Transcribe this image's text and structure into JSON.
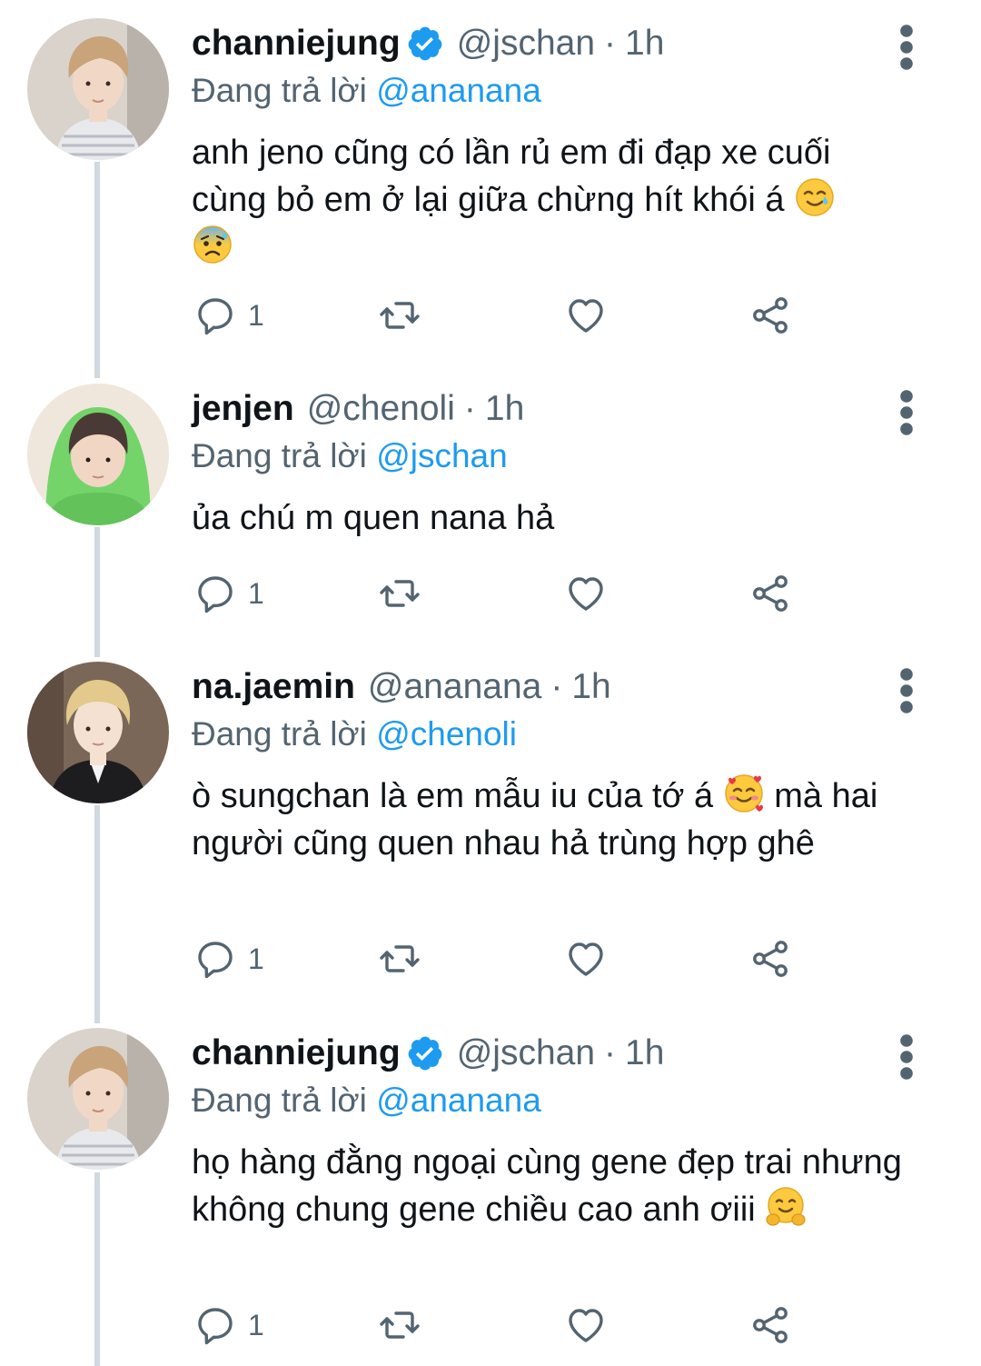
{
  "tweets": [
    {
      "display_name": "channiejung",
      "verified": true,
      "handle": "@jschan",
      "separator": "·",
      "time": "1h",
      "replying_prefix": "Đang trả lời",
      "replying_to": "@ananana",
      "text": "anh jeno cũng có lần rủ em đi đạp xe cuối cùng bỏ em ở lại giữa chừng hít khói á",
      "emojis": [
        "smiling-face-with-tear",
        "anxious-face-with-sweat"
      ],
      "reply_count": "1",
      "avatar_colors": {
        "bg": "#d9d3cc",
        "hair": "#c9a37a",
        "skin": "#f1d8c6",
        "shirt": "#e8e9ec"
      }
    },
    {
      "display_name": "jenjen",
      "verified": false,
      "handle": "@chenoli",
      "separator": "·",
      "time": "1h",
      "replying_prefix": "Đang trả lời",
      "replying_to": "@jschan",
      "text": "ủa chú m quen nana hả",
      "emojis": [],
      "reply_count": "1",
      "avatar_colors": {
        "bg": "#efe7dc",
        "hair": "#4a3a36",
        "skin": "#f2d6c4",
        "shirt": "#74d46a"
      }
    },
    {
      "display_name": "na.jaemin",
      "verified": false,
      "handle": "@ananana",
      "separator": "·",
      "time": "1h",
      "replying_prefix": "Đang trả lời",
      "replying_to": "@chenoli",
      "text_before_emoji": "ò sungchan là em mẫu iu của tớ á",
      "text_after_emoji": "mà hai người cũng quen nhau hả trùng hợp ghê",
      "emojis": [
        "smiling-face-with-hearts"
      ],
      "reply_count": "1",
      "avatar_colors": {
        "bg": "#7a6757",
        "hair": "#e3c98b",
        "skin": "#f4e1d2",
        "shirt": "#1d1d20"
      }
    },
    {
      "display_name": "channiejung",
      "verified": true,
      "handle": "@jschan",
      "separator": "·",
      "time": "1h",
      "replying_prefix": "Đang trả lời",
      "replying_to": "@ananana",
      "text": "họ hàng đằng ngoại cùng gene đẹp trai nhưng không chung gene chiều cao anh ơiii",
      "emojis": [
        "hugging-face"
      ],
      "reply_count": "1",
      "avatar_colors": {
        "bg": "#d9d3cc",
        "hair": "#c9a37a",
        "skin": "#f1d8c6",
        "shirt": "#e8e9ec"
      }
    }
  ],
  "colors": {
    "text": "#0f1419",
    "secondary": "#536471",
    "link": "#1d9bf0",
    "thread_line": "#cfd9de",
    "verified": "#1d9bf0"
  }
}
